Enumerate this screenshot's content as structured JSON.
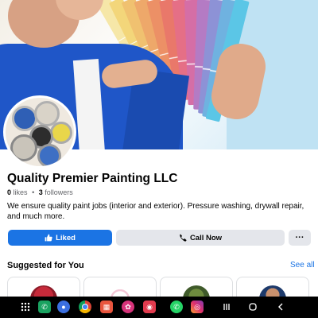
{
  "page": {
    "name": "Quality Premier Painting LLC",
    "likes_count": "0",
    "likes_label": "likes",
    "separator": "•",
    "followers_count": "3",
    "followers_label": "followers",
    "description": "We ensure quality paint jobs (interior and exterior). Pressure washing, drywall repair, and much more."
  },
  "actions": {
    "liked_label": "Liked",
    "call_label": "Call Now",
    "more_label": "···"
  },
  "suggested": {
    "title": "Suggested for You",
    "see_all": "See all"
  },
  "colors": {
    "accent": "#1b74e4",
    "button_gray": "#e4e6eb",
    "text_secondary": "#65676b",
    "navbar": "#000000"
  },
  "navbar": {
    "icons": [
      "app-grid-icon",
      "phone-app-icon",
      "messages-app-icon",
      "chrome-app-icon",
      "gallery-app-icon",
      "flower-app-icon",
      "camera-app-icon",
      "whatsapp-app-icon",
      "instagram-app-icon",
      "recents-icon",
      "home-icon",
      "back-icon"
    ]
  }
}
